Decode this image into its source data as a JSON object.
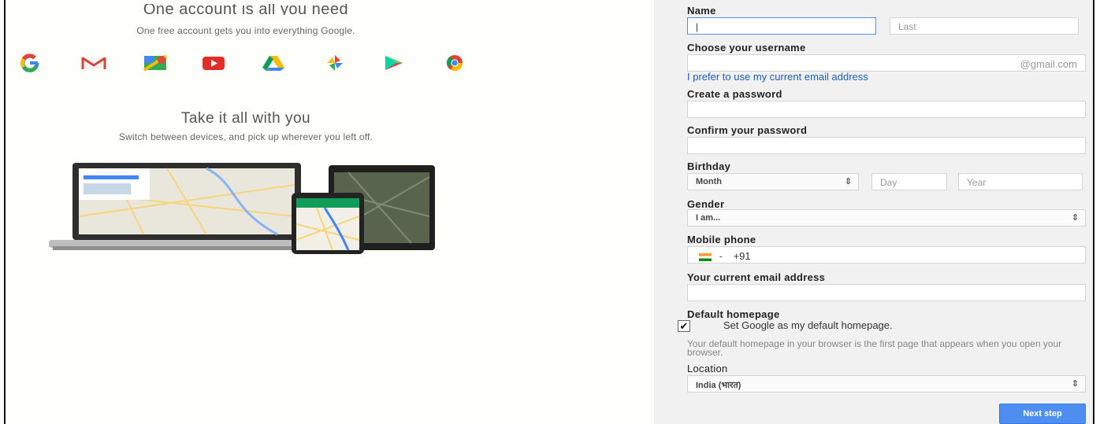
{
  "left": {
    "heading1": "One account is all you need",
    "subtitle1": "One free account gets you into everything Google.",
    "heading2": "Take it all with you",
    "subtitle2": "Switch between devices, and pick up wherever you left off.",
    "app_icons": [
      "google-icon",
      "gmail-icon",
      "maps-icon",
      "youtube-icon",
      "drive-icon",
      "photos-icon",
      "play-icon",
      "chrome-icon"
    ]
  },
  "form": {
    "name": {
      "label": "Name",
      "first_value": "|",
      "last_placeholder": "Last"
    },
    "username": {
      "label": "Choose your username",
      "suffix": "@gmail.com",
      "alt_link": "I prefer to use my current email address"
    },
    "password": {
      "label": "Create a password"
    },
    "confirm": {
      "label": "Confirm your password"
    },
    "birthday": {
      "label": "Birthday",
      "month": "Month",
      "day_placeholder": "Day",
      "year_placeholder": "Year"
    },
    "gender": {
      "label": "Gender",
      "value": "I am..."
    },
    "phone": {
      "label": "Mobile phone",
      "code": "+91",
      "flag_dash": "-"
    },
    "current_email": {
      "label": "Your current email address"
    },
    "homepage": {
      "label": "Default homepage",
      "checkbox_label": "Set Google as my default homepage.",
      "checked": "✔",
      "note": "Your default homepage in your browser is the first page that appears when you open your browser."
    },
    "location": {
      "label": "Location",
      "value": "India (भारत)"
    },
    "next_button": "Next step"
  },
  "colors": {
    "link": "#1a5bbf",
    "button": "#4d8ef0",
    "focus": "#4d90fe",
    "panel": "#f1f1f1"
  }
}
